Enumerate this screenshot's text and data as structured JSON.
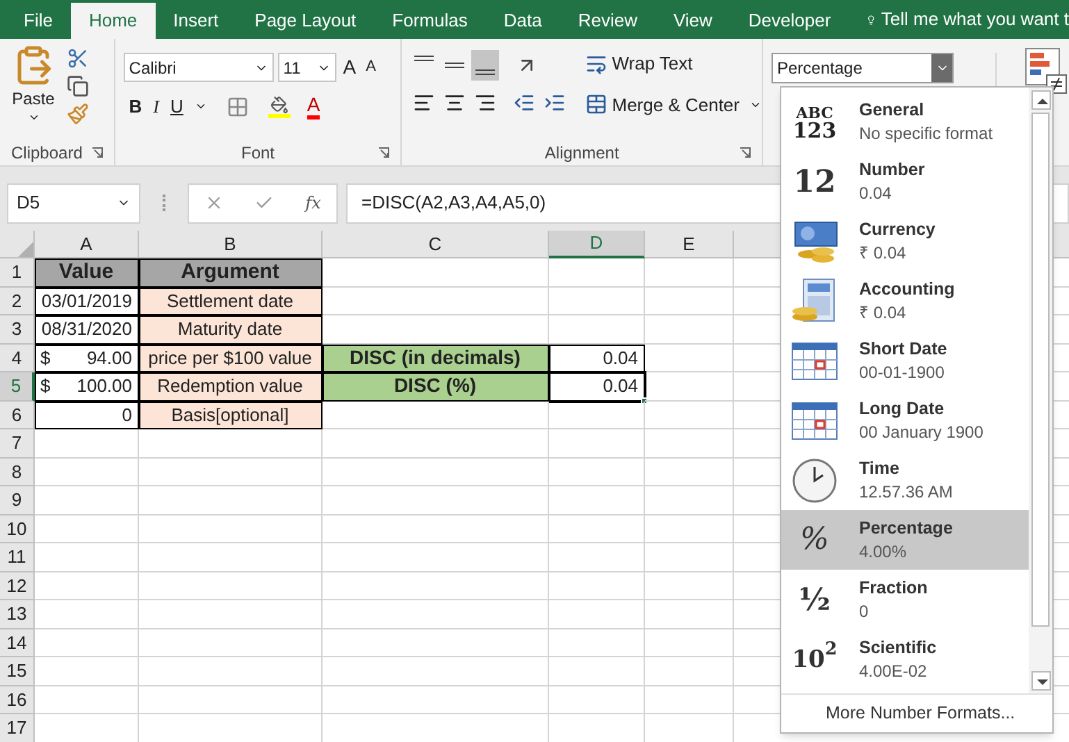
{
  "tabs": [
    {
      "label": "File",
      "selected": false
    },
    {
      "label": "Home",
      "selected": true
    },
    {
      "label": "Insert",
      "selected": false
    },
    {
      "label": "Page Layout",
      "selected": false
    },
    {
      "label": "Formulas",
      "selected": false
    },
    {
      "label": "Data",
      "selected": false
    },
    {
      "label": "Review",
      "selected": false
    },
    {
      "label": "View",
      "selected": false
    },
    {
      "label": "Developer",
      "selected": false
    }
  ],
  "tell_me": "Tell me what you want t",
  "ribbon": {
    "clipboard": {
      "paste": "Paste",
      "label": "Clipboard"
    },
    "font": {
      "name": "Calibri",
      "size": "11",
      "grow": "A",
      "shrink": "A",
      "bold": "B",
      "italic": "I",
      "underline": "U",
      "font_color": "A",
      "label": "Font"
    },
    "alignment": {
      "vertical": [
        {
          "kind": "top",
          "selected": false
        },
        {
          "kind": "middle",
          "selected": false
        },
        {
          "kind": "bottom",
          "selected": true
        }
      ],
      "wrap": "Wrap Text",
      "merge": "Merge & Center",
      "label": "Alignment"
    },
    "number_format": {
      "value": "Percentage"
    }
  },
  "formula_bar": {
    "name_box": "D5",
    "fx": "fx",
    "formula": "=DISC(A2,A3,A4,A5,0)"
  },
  "sheet": {
    "columns": [
      {
        "label": "A",
        "selected": false
      },
      {
        "label": "B",
        "selected": false
      },
      {
        "label": "C",
        "selected": false
      },
      {
        "label": "D",
        "selected": true
      },
      {
        "label": "E",
        "selected": false
      }
    ],
    "rows": [
      {
        "label": "1",
        "selected": false,
        "cells": [
          {
            "kind": "header",
            "text": "Value"
          },
          {
            "kind": "header",
            "text": "Argument"
          },
          {},
          {},
          {}
        ]
      },
      {
        "label": "2",
        "selected": false,
        "cells": [
          {
            "kind": "value",
            "text": "03/01/2019"
          },
          {
            "kind": "label",
            "text": "Settlement date"
          },
          {},
          {},
          {}
        ]
      },
      {
        "label": "3",
        "selected": false,
        "cells": [
          {
            "kind": "value",
            "text": "08/31/2020"
          },
          {
            "kind": "label",
            "text": "Maturity date"
          },
          {},
          {},
          {}
        ]
      },
      {
        "label": "4",
        "selected": false,
        "cells": [
          {
            "kind": "accounting",
            "symbol": "$",
            "text": "94.00"
          },
          {
            "kind": "label",
            "text": "price per $100 value"
          },
          {
            "kind": "result-label",
            "text": "DISC (in decimals)"
          },
          {
            "kind": "value",
            "text": "0.04"
          },
          {}
        ]
      },
      {
        "label": "5",
        "selected": true,
        "cells": [
          {
            "kind": "accounting",
            "symbol": "$",
            "text": "100.00"
          },
          {
            "kind": "label",
            "text": "Redemption value"
          },
          {
            "kind": "result-label",
            "text": "DISC (%)"
          },
          {
            "kind": "value",
            "text": "0.04"
          },
          {}
        ]
      },
      {
        "label": "6",
        "selected": false,
        "cells": [
          {
            "kind": "value",
            "text": "0"
          },
          {
            "kind": "label",
            "text": "Basis[optional]"
          },
          {},
          {},
          {}
        ]
      },
      {
        "label": "7",
        "selected": false,
        "cells": []
      },
      {
        "label": "8",
        "selected": false,
        "cells": []
      },
      {
        "label": "9",
        "selected": false,
        "cells": []
      },
      {
        "label": "10",
        "selected": false,
        "cells": []
      },
      {
        "label": "11",
        "selected": false,
        "cells": []
      },
      {
        "label": "12",
        "selected": false,
        "cells": []
      },
      {
        "label": "13",
        "selected": false,
        "cells": []
      },
      {
        "label": "14",
        "selected": false,
        "cells": []
      },
      {
        "label": "15",
        "selected": false,
        "cells": []
      },
      {
        "label": "16",
        "selected": false,
        "cells": []
      },
      {
        "label": "17",
        "selected": false,
        "cells": []
      }
    ]
  },
  "format_menu": {
    "items": [
      {
        "kind": "general",
        "glyph": [
          "ABC",
          "123"
        ],
        "title": "General",
        "example": "No specific format",
        "selected": false
      },
      {
        "kind": "number",
        "glyph": [
          "12"
        ],
        "title": "Number",
        "example": "0.04",
        "selected": false
      },
      {
        "kind": "currency",
        "title": "Currency",
        "example": "₹ 0.04",
        "selected": false
      },
      {
        "kind": "accounting",
        "title": "Accounting",
        "example": "₹ 0.04",
        "selected": false
      },
      {
        "kind": "short-date",
        "title": "Short Date",
        "example": "00-01-1900",
        "selected": false
      },
      {
        "kind": "long-date",
        "title": "Long Date",
        "example": "00 January 1900",
        "selected": false
      },
      {
        "kind": "time",
        "title": "Time",
        "example": "12.57.36 AM",
        "selected": false
      },
      {
        "kind": "percentage",
        "glyph": [
          "%"
        ],
        "title": "Percentage",
        "example": "4.00%",
        "selected": true
      },
      {
        "kind": "fraction",
        "glyph": [
          "½"
        ],
        "title": "Fraction",
        "example": "0",
        "selected": false
      },
      {
        "kind": "scientific",
        "glyph": [
          "10$^{2}$"
        ],
        "title": "Scientific",
        "example": "4.00E-02",
        "selected": false
      }
    ],
    "more": "More Number Formats..."
  }
}
